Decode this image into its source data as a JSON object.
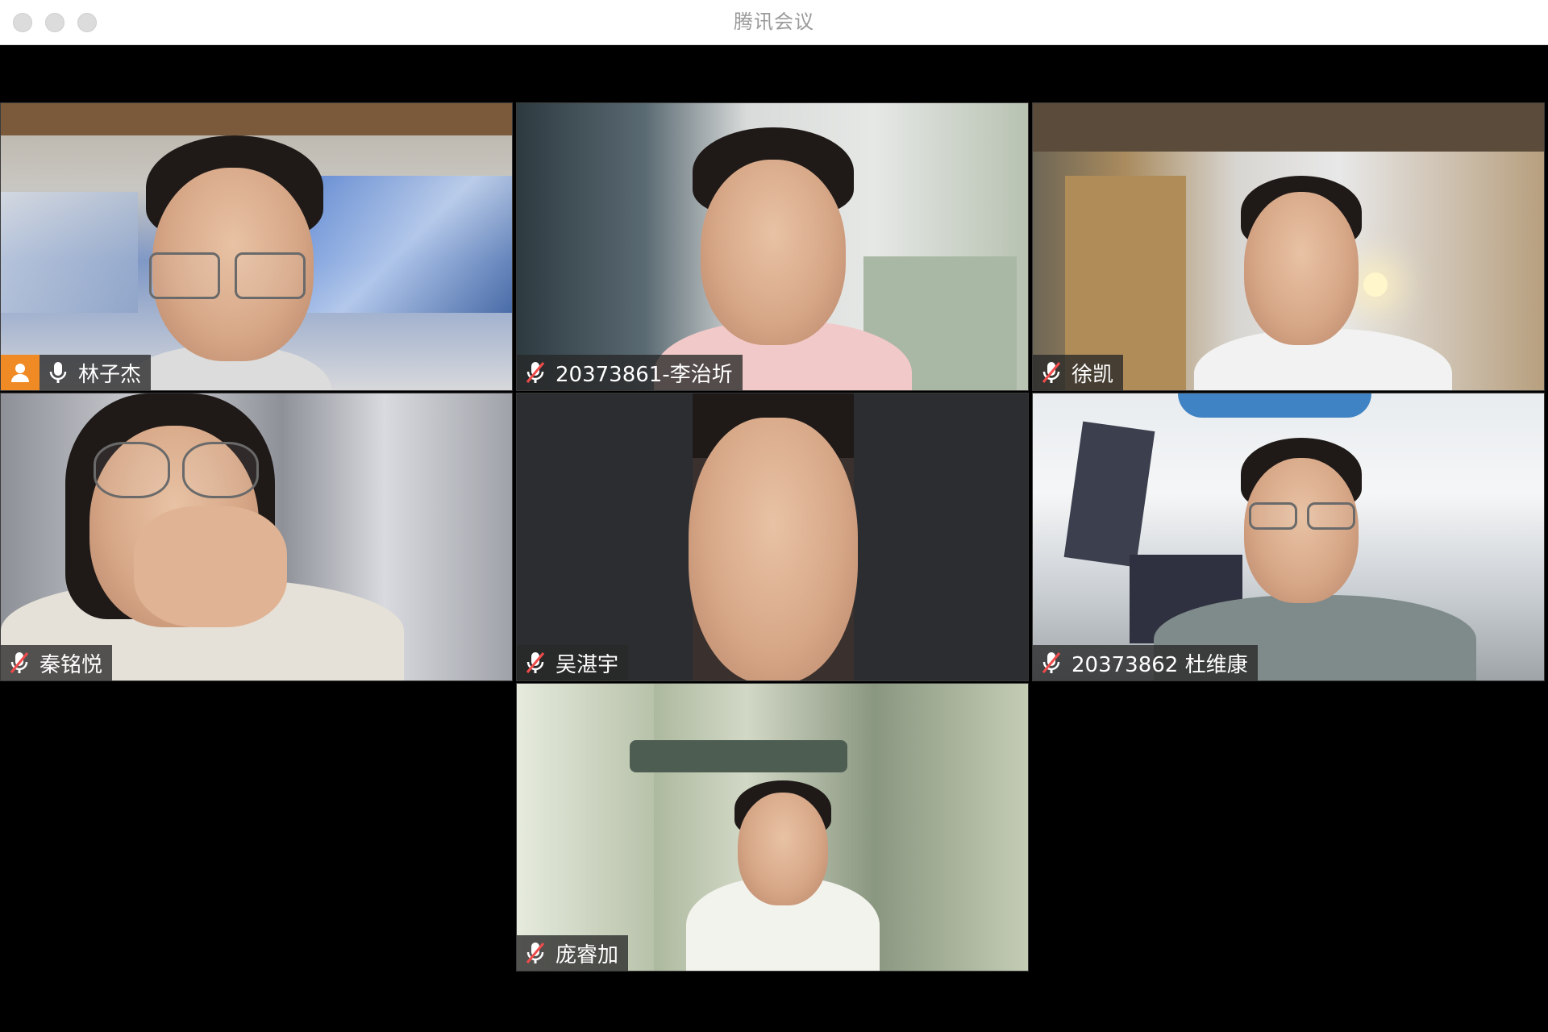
{
  "window": {
    "title": "腾讯会议"
  },
  "participants": [
    {
      "name": "林子杰",
      "muted": false,
      "host": true
    },
    {
      "name": "20373861-李治圻",
      "muted": true,
      "host": false
    },
    {
      "name": "徐凯",
      "muted": true,
      "host": false
    },
    {
      "name": "秦铭悦",
      "muted": true,
      "host": false
    },
    {
      "name": "吴湛宇",
      "muted": true,
      "host": false
    },
    {
      "name": "20373862 杜维康",
      "muted": true,
      "host": false
    },
    {
      "name": "庞睿加",
      "muted": true,
      "host": false
    }
  ],
  "icons": {
    "mic": "mic-icon",
    "mic_muted": "mic-muted-icon",
    "host": "host-person-icon"
  },
  "colors": {
    "host_badge": "#f08a24",
    "background": "#000000",
    "title_text": "#9a9a9a"
  }
}
